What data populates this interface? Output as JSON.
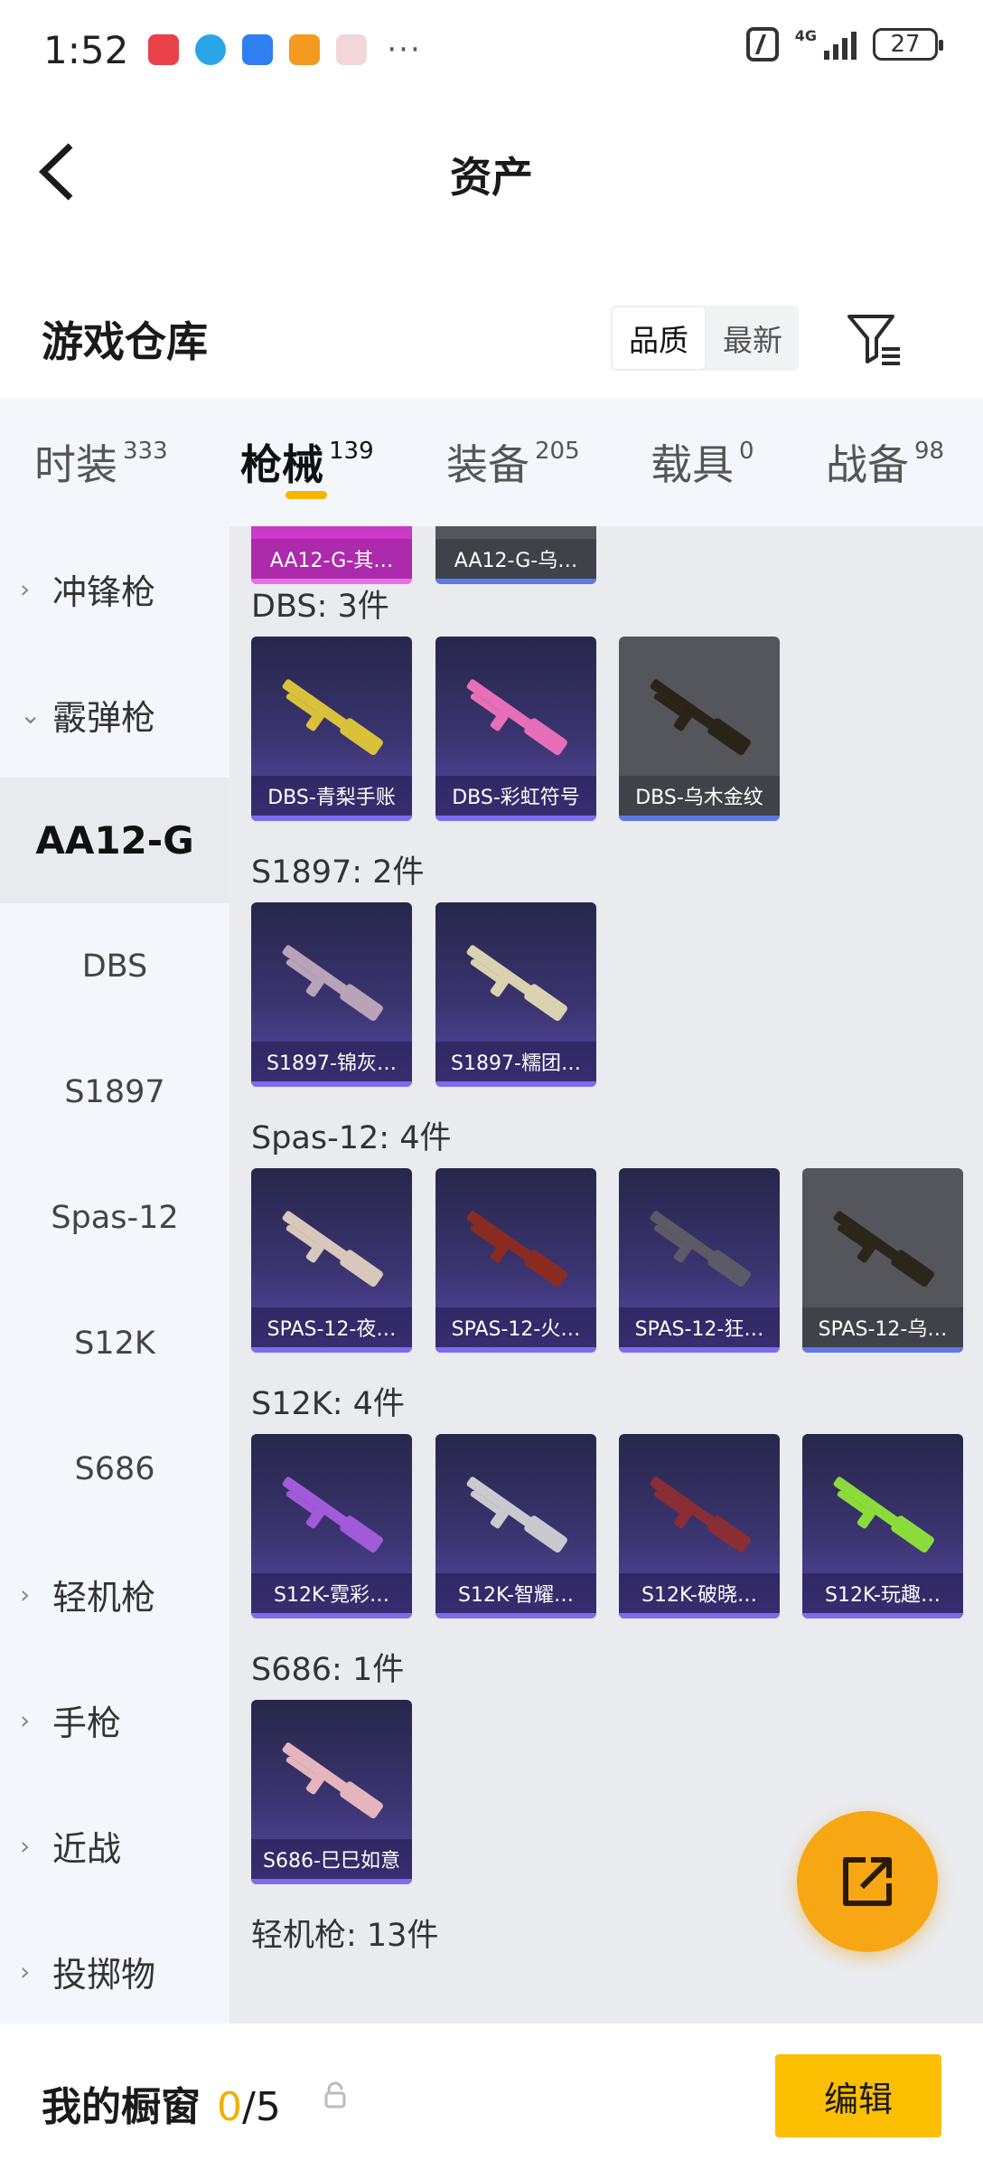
{
  "status_bar": {
    "time": "1:52",
    "network": "4G",
    "battery": "27"
  },
  "nav": {
    "title": "资产"
  },
  "warehouse": {
    "title": "游戏仓库",
    "sort_options": [
      "品质",
      "最新"
    ],
    "active_sort": "品质"
  },
  "tabs": [
    {
      "label": "时装",
      "count": "333"
    },
    {
      "label": "枪械",
      "count": "139",
      "active": true
    },
    {
      "label": "装备",
      "count": "205"
    },
    {
      "label": "载具",
      "count": "0"
    },
    {
      "label": "战备",
      "count": "98"
    }
  ],
  "sidebar": [
    {
      "label": "冲锋枪",
      "type": "group",
      "chevron": "›"
    },
    {
      "label": "霰弹枪",
      "type": "group",
      "chevron": "⌄"
    },
    {
      "label": "AA12-G",
      "type": "active"
    },
    {
      "label": "DBS",
      "type": "sub"
    },
    {
      "label": "S1897",
      "type": "sub"
    },
    {
      "label": "Spas-12",
      "type": "sub"
    },
    {
      "label": "S12K",
      "type": "sub"
    },
    {
      "label": "S686",
      "type": "sub"
    },
    {
      "label": "轻机枪",
      "type": "group",
      "chevron": "›"
    },
    {
      "label": "手枪",
      "type": "group",
      "chevron": "›"
    },
    {
      "label": "近战",
      "type": "group",
      "chevron": "›"
    },
    {
      "label": "投掷物",
      "type": "group",
      "chevron": "›"
    }
  ],
  "content": {
    "top_partial": [
      {
        "name": "AA12-G-其…",
        "style": "magenta"
      },
      {
        "name": "AA12-G-乌…",
        "style": "gray"
      }
    ],
    "sections": [
      {
        "label": "DBS: 3件",
        "items": [
          {
            "name": "DBS-青梨手账",
            "style": "purple",
            "gun": "#d9c23a"
          },
          {
            "name": "DBS-彩虹符号",
            "style": "purple",
            "gun": "#e66fb8"
          },
          {
            "name": "DBS-乌木金纹",
            "style": "gray",
            "gun": "#2a2418"
          }
        ]
      },
      {
        "label": "S1897: 2件",
        "items": [
          {
            "name": "S1897-锦灰…",
            "style": "purple",
            "gun": "#b9a3b8"
          },
          {
            "name": "S1897-糯团…",
            "style": "purple",
            "gun": "#d9d2b0"
          }
        ]
      },
      {
        "label": "Spas-12: 4件",
        "items": [
          {
            "name": "SPAS-12-夜…",
            "style": "purple",
            "gun": "#d8c8bb"
          },
          {
            "name": "SPAS-12-火…",
            "style": "purple",
            "gun": "#8a2b22"
          },
          {
            "name": "SPAS-12-狂…",
            "style": "purple",
            "gun": "#5c5a66"
          },
          {
            "name": "SPAS-12-乌…",
            "style": "gray",
            "gun": "#2b261a"
          }
        ]
      },
      {
        "label": "S12K: 4件",
        "items": [
          {
            "name": "S12K-霓彩…",
            "style": "purple",
            "gun": "#a15ad8"
          },
          {
            "name": "S12K-智耀…",
            "style": "purple",
            "gun": "#c9c9cf"
          },
          {
            "name": "S12K-破晓…",
            "style": "purple",
            "gun": "#8a2d34"
          },
          {
            "name": "S12K-玩趣…",
            "style": "purple",
            "gun": "#8bdc3b"
          }
        ]
      },
      {
        "label": "S686: 1件",
        "items": [
          {
            "name": "S686-巳巳如意",
            "style": "purple",
            "gun": "#e4b5bd"
          }
        ]
      },
      {
        "label": "轻机枪: 13件",
        "items": []
      }
    ]
  },
  "bottom": {
    "title": "我的橱窗",
    "count": "0",
    "total": "/5",
    "edit_label": "编辑"
  },
  "colors": {
    "accent": "#f7b500",
    "fab": "#f6a713",
    "edit_button": "#fcbf02"
  }
}
